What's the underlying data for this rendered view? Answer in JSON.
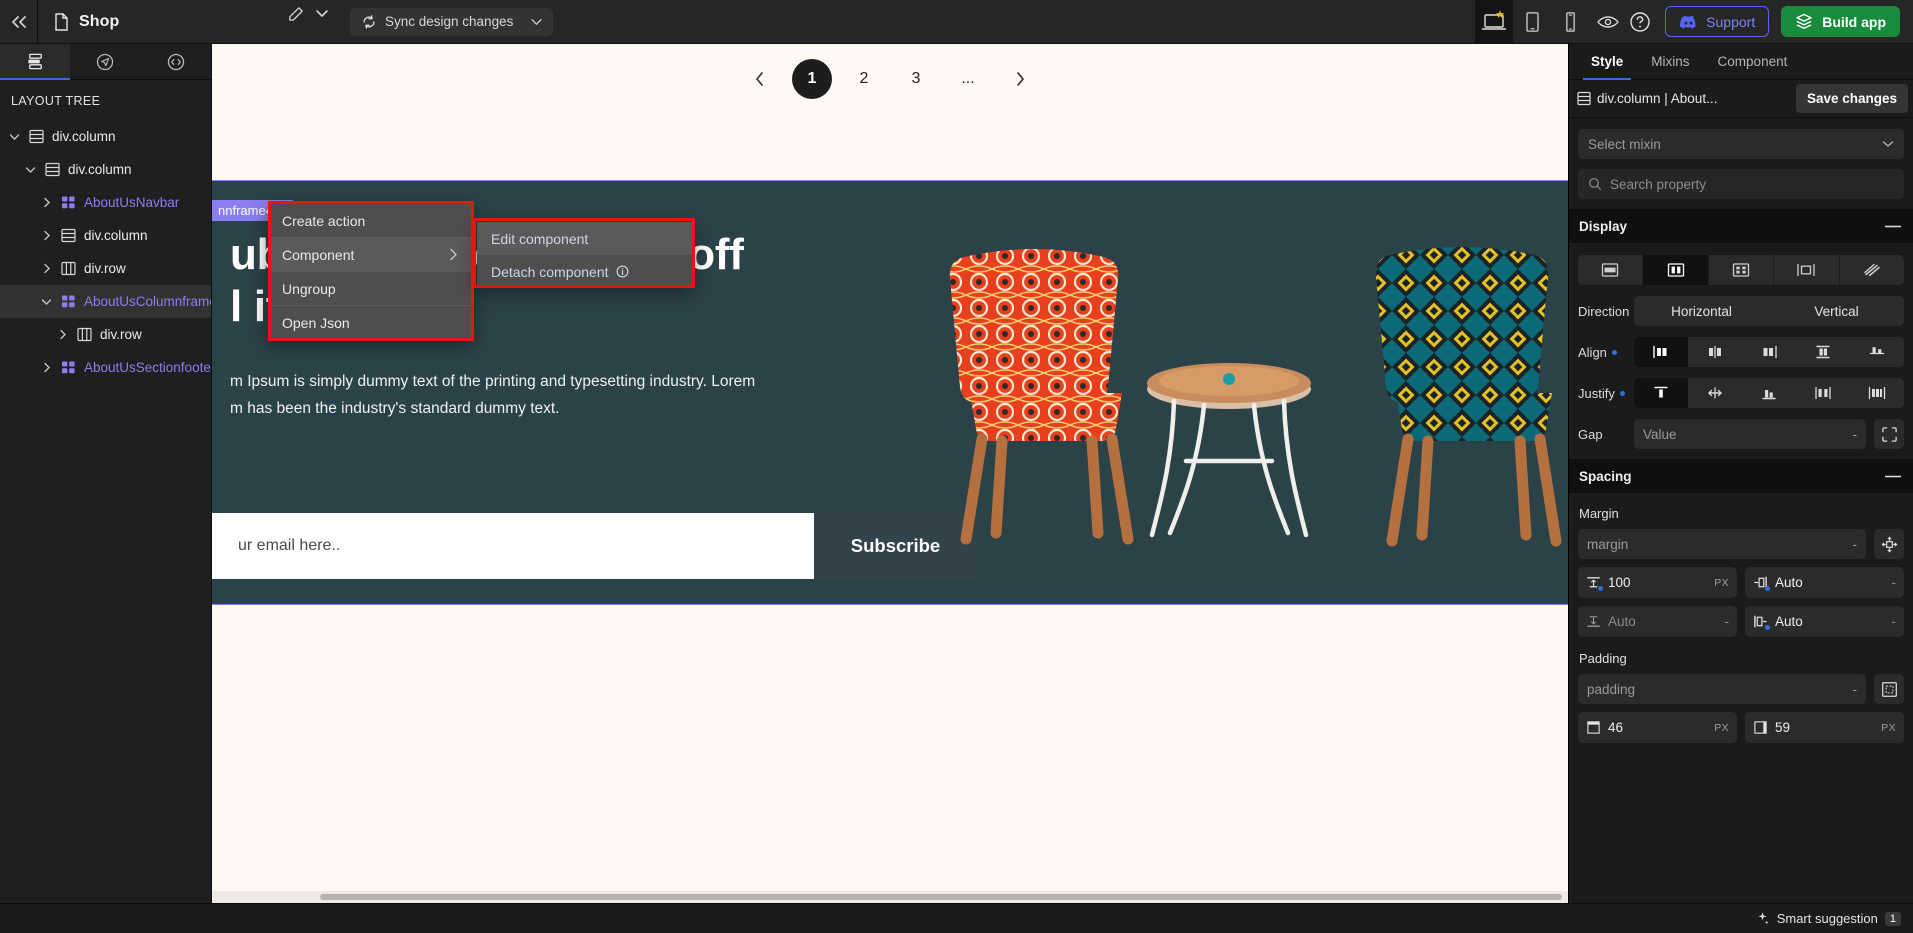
{
  "topbar": {
    "collapse_icon": "double-chevron-left-icon",
    "page_icon": "file-icon",
    "page_name": "Shop",
    "edit_icon": "edit-pencil-icon",
    "dropdown_icon": "chevron-down-icon",
    "sync_label": "Sync design changes",
    "sync_icon": "sync-icon",
    "sync_caret": "chevron-down-icon",
    "devices": [
      {
        "name": "desktop",
        "icon": "laptop-icon",
        "active": true,
        "badge": "star"
      },
      {
        "name": "tablet",
        "icon": "tablet-icon",
        "active": false
      },
      {
        "name": "mobile",
        "icon": "mobile-icon",
        "active": false
      },
      {
        "name": "preview",
        "icon": "eye-icon",
        "active": false
      }
    ],
    "help_icon": "question-circle-icon",
    "support_label": "Support",
    "support_icon": "discord-icon",
    "support_color": "#5865f2",
    "build_label": "Build app",
    "build_icon": "layers-icon",
    "build_color": "#1a8a3c"
  },
  "left_panel": {
    "tabs": [
      {
        "name": "layers",
        "icon": "layers-stack-icon",
        "active": true
      },
      {
        "name": "actions",
        "icon": "navigate-circle-icon",
        "active": false
      },
      {
        "name": "code",
        "icon": "code-circle-icon",
        "active": false
      }
    ],
    "title": "LAYOUT TREE",
    "tree": [
      {
        "label": "div.column",
        "icon": "rows-icon",
        "caret": "down",
        "indent": 0,
        "component": false,
        "selected": false
      },
      {
        "label": "div.column",
        "icon": "rows-icon",
        "caret": "down",
        "indent": 1,
        "component": false,
        "selected": false
      },
      {
        "label": "AboutUsNavbar",
        "icon": "component-grid-icon",
        "caret": "right",
        "indent": 2,
        "component": true,
        "selected": false
      },
      {
        "label": "div.column",
        "icon": "rows-icon",
        "caret": "right",
        "indent": 2,
        "component": false,
        "selected": false
      },
      {
        "label": "div.row",
        "icon": "columns-icon",
        "caret": "right",
        "indent": 2,
        "component": false,
        "selected": false
      },
      {
        "label": "AboutUsColumnframe",
        "icon": "component-grid-icon",
        "caret": "down",
        "indent": 2,
        "component": true,
        "selected": true
      },
      {
        "label": "div.row",
        "icon": "columns-icon",
        "caret": "right",
        "indent": 3,
        "component": false,
        "selected": false
      },
      {
        "label": "AboutUsSectionfooter",
        "icon": "component-grid-icon",
        "caret": "right",
        "indent": 2,
        "component": true,
        "selected": false
      }
    ]
  },
  "canvas": {
    "pagination": {
      "prev_icon": "chevron-left-icon",
      "next_icon": "chevron-right-icon",
      "pages": [
        "1",
        "2",
        "3",
        "..."
      ],
      "active_page": "1"
    },
    "selection_badge": "nnframe480",
    "hero": {
      "heading_line1": "ubscribe and get 10% off",
      "heading_line2": "l items",
      "paragraph_line1": "m Ipsum is simply dummy text of the printing and typesetting industry. Lorem",
      "paragraph_line2": "m has been the industry's standard dummy text.",
      "email_placeholder": "ur email here..",
      "subscribe_label": "Subscribe",
      "bg_color": "#2b4248"
    }
  },
  "context_menu": {
    "items": [
      {
        "label": "Create action",
        "submenu": false,
        "highlighted": false
      },
      {
        "label": "Component",
        "submenu": true,
        "highlighted": true,
        "arrow_icon": "chevron-right-icon"
      },
      {
        "label": "Ungroup",
        "submenu": false,
        "highlighted": false
      },
      {
        "label": "Open Json",
        "submenu": false,
        "highlighted": false
      }
    ],
    "submenu": {
      "items": [
        {
          "label": "Edit component",
          "highlighted": true,
          "info": false
        },
        {
          "label": "Detach component",
          "highlighted": false,
          "info": true,
          "info_icon": "info-circle-icon"
        }
      ]
    },
    "annotation_color": "#f01010"
  },
  "right_panel": {
    "tabs": [
      {
        "label": "Style",
        "active": true
      },
      {
        "label": "Mixins",
        "active": false
      },
      {
        "label": "Component",
        "active": false
      }
    ],
    "selection_icon": "rows-icon",
    "selection_label": "div.column | About...",
    "save_label": "Save changes",
    "mixin_placeholder": "Select mixin",
    "mixin_caret": "chevron-down-icon",
    "search_icon": "search-icon",
    "search_placeholder": "Search property",
    "display": {
      "title": "Display",
      "collapse_icon": "minus-icon",
      "modes": [
        {
          "name": "display-block",
          "icon": "block-icon",
          "active": false
        },
        {
          "name": "display-flex",
          "icon": "flex-icon",
          "active": true
        },
        {
          "name": "display-grid",
          "icon": "grid-icon",
          "active": false
        },
        {
          "name": "display-inline-block",
          "icon": "inline-block-icon",
          "active": false
        },
        {
          "name": "display-none",
          "icon": "none-icon",
          "active": false
        }
      ],
      "direction_label": "Direction",
      "direction_options": [
        "Horizontal",
        "Vertical"
      ],
      "direction_value": "Horizontal",
      "align_label": "Align",
      "align_active_index": 0,
      "justify_label": "Justify",
      "justify_active_index": 0,
      "gap_label": "Gap",
      "gap_placeholder": "Value",
      "gap_unit": "-",
      "gap_link_icon": "corner-brackets-icon"
    },
    "spacing": {
      "title": "Spacing",
      "collapse_icon": "minus-icon",
      "margin_label": "Margin",
      "margin_placeholder": "margin",
      "margin_unit": "-",
      "margin_all_icon": "margin-all-icon",
      "margin_top": {
        "value": "100",
        "unit": "PX",
        "icon": "margin-top-icon",
        "dim": false
      },
      "margin_right": {
        "value": "Auto",
        "unit": "-",
        "icon": "margin-right-icon",
        "dim": false
      },
      "margin_bottom": {
        "value": "Auto",
        "unit": "-",
        "icon": "margin-bottom-icon",
        "dim": true
      },
      "margin_left": {
        "value": "Auto",
        "unit": "-",
        "icon": "margin-left-icon",
        "dim": false
      },
      "padding_label": "Padding",
      "padding_placeholder": "padding",
      "padding_unit": "-",
      "padding_all_icon": "padding-all-icon",
      "padding_top": {
        "value": "46",
        "unit": "PX",
        "icon": "padding-top-icon",
        "dim": false
      },
      "padding_right": {
        "value": "59",
        "unit": "PX",
        "icon": "padding-right-icon",
        "dim": false
      }
    }
  },
  "status_bar": {
    "icon": "sparkle-icon",
    "label": "Smart suggestion",
    "count": "1"
  }
}
